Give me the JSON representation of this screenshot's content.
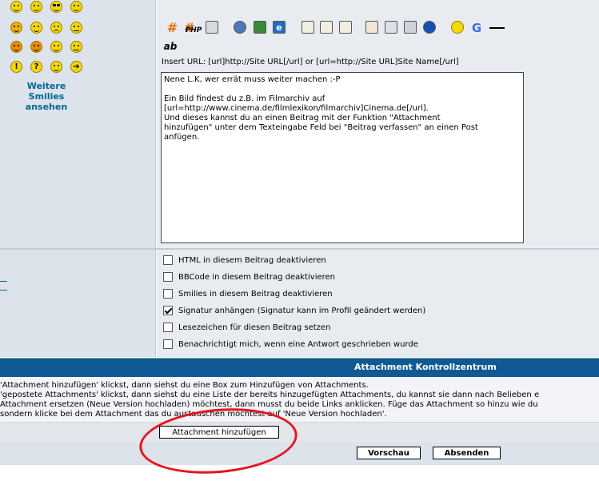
{
  "smilies": {
    "more_label": "Weitere Smilies ansehen"
  },
  "toolbar": {
    "hash_glyph": "#",
    "php_label": "PHP",
    "ie_glyph": "e",
    "google_glyph": "G",
    "ab_label": "ab"
  },
  "insert_url": "Insert URL: [url]http://Site URL[/url] or [url=http://Site URL]Site Name[/url]",
  "message": {
    "text": "Nene L.K, wer errät muss weiter machen :-P\n\nEin Bild findest du z.B. im Filmarchiv auf\n[url=http://www.cinema.de/filmlexikon/filmarchiv]Cinema.de[/url].\nUnd dieses kannst du an einen Beitrag mit der Funktion \"Attachment\nhinzufügen\" unter dem Texteingabe Feld bei \"Beitrag verfassen\" an einen Post\nanfügen."
  },
  "options": [
    {
      "label": "HTML in diesem Beitrag deaktivieren",
      "checked": false
    },
    {
      "label": "BBCode in diesem Beitrag deaktivieren",
      "checked": false
    },
    {
      "label": "Smilies in diesem Beitrag deaktivieren",
      "checked": false
    },
    {
      "label": "Signatur anhängen (Signatur kann im Profil geändert werden)",
      "checked": true
    },
    {
      "label": "Lesezeichen für diesen Beitrag setzen",
      "checked": false
    },
    {
      "label": "Benachrichtigt mich, wenn eine Antwort geschrieben wurde",
      "checked": false
    }
  ],
  "attachment": {
    "title": "Attachment Kontrollzentrum",
    "lines": [
      "'Attachment hinzufügen' klickst, dann siehst du eine Box zum Hinzufügen von Attachments.",
      "'gepostete Attachments' klickst, dann siehst du eine Liste der bereits hinzugefügten Attachments, du kannst sie dann nach Belieben e",
      "Attachment ersetzen (Neue Version hochladen) möchtest, dann musst du beide Links anklicken. Füge das Attachment so hinzu wie du",
      "sondern klicke bei dem Attachment das du austauschen möchtest auf 'Neue Version hochladen'."
    ],
    "add_button": "Attachment hinzufügen"
  },
  "buttons": {
    "preview": "Vorschau",
    "submit": "Absenden"
  },
  "colors": {
    "header_bg": "#0f5a94",
    "link": "#006699",
    "annotation": "#e8141e"
  }
}
